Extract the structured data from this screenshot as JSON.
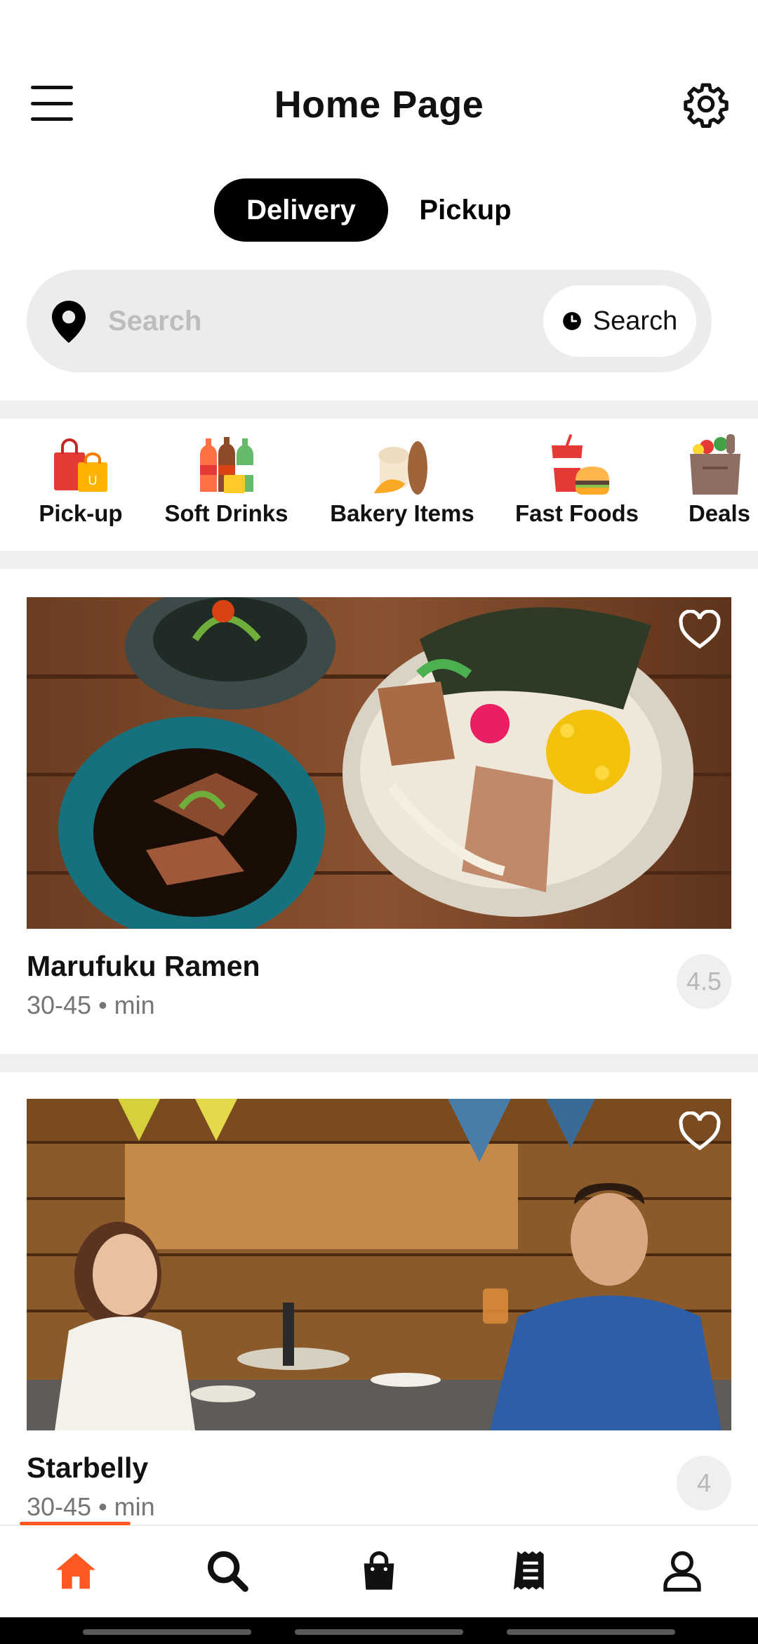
{
  "header": {
    "title": "Home Page",
    "menu_icon": "hamburger-menu-icon",
    "settings_icon": "gear-icon"
  },
  "tabs": [
    {
      "label": "Delivery",
      "selected": true
    },
    {
      "label": "Pickup",
      "selected": false
    }
  ],
  "search": {
    "placeholder": "Search",
    "value": "",
    "button_label": "Search",
    "location_icon": "location-pin-icon",
    "button_icon": "clock-icon"
  },
  "categories": [
    {
      "label": "Pick-up",
      "icon": "shopping-bags-icon"
    },
    {
      "label": "Soft Drinks",
      "icon": "soda-bottles-icon"
    },
    {
      "label": "Bakery Items",
      "icon": "bread-icon"
    },
    {
      "label": "Fast Foods",
      "icon": "burger-drink-icon"
    },
    {
      "label": "Deals",
      "icon": "grocery-bag-icon"
    }
  ],
  "restaurants": [
    {
      "name": "Marufuku Ramen",
      "meta": "30-45 • min",
      "rating": "4.5",
      "favorite_icon": "heart-outline-icon"
    },
    {
      "name": "Starbelly",
      "meta": "30-45 • min",
      "rating": "4",
      "favorite_icon": "heart-outline-icon"
    }
  ],
  "bottom_nav": [
    {
      "icon": "home-icon",
      "active": true
    },
    {
      "icon": "search-icon",
      "active": false
    },
    {
      "icon": "shopping-bag-icon",
      "active": false
    },
    {
      "icon": "receipt-icon",
      "active": false
    },
    {
      "icon": "profile-icon",
      "active": false
    }
  ],
  "colors": {
    "accent": "#ff5722",
    "segment_active_bg": "#000000",
    "search_bg": "#ececec",
    "muted_text": "#757575"
  }
}
